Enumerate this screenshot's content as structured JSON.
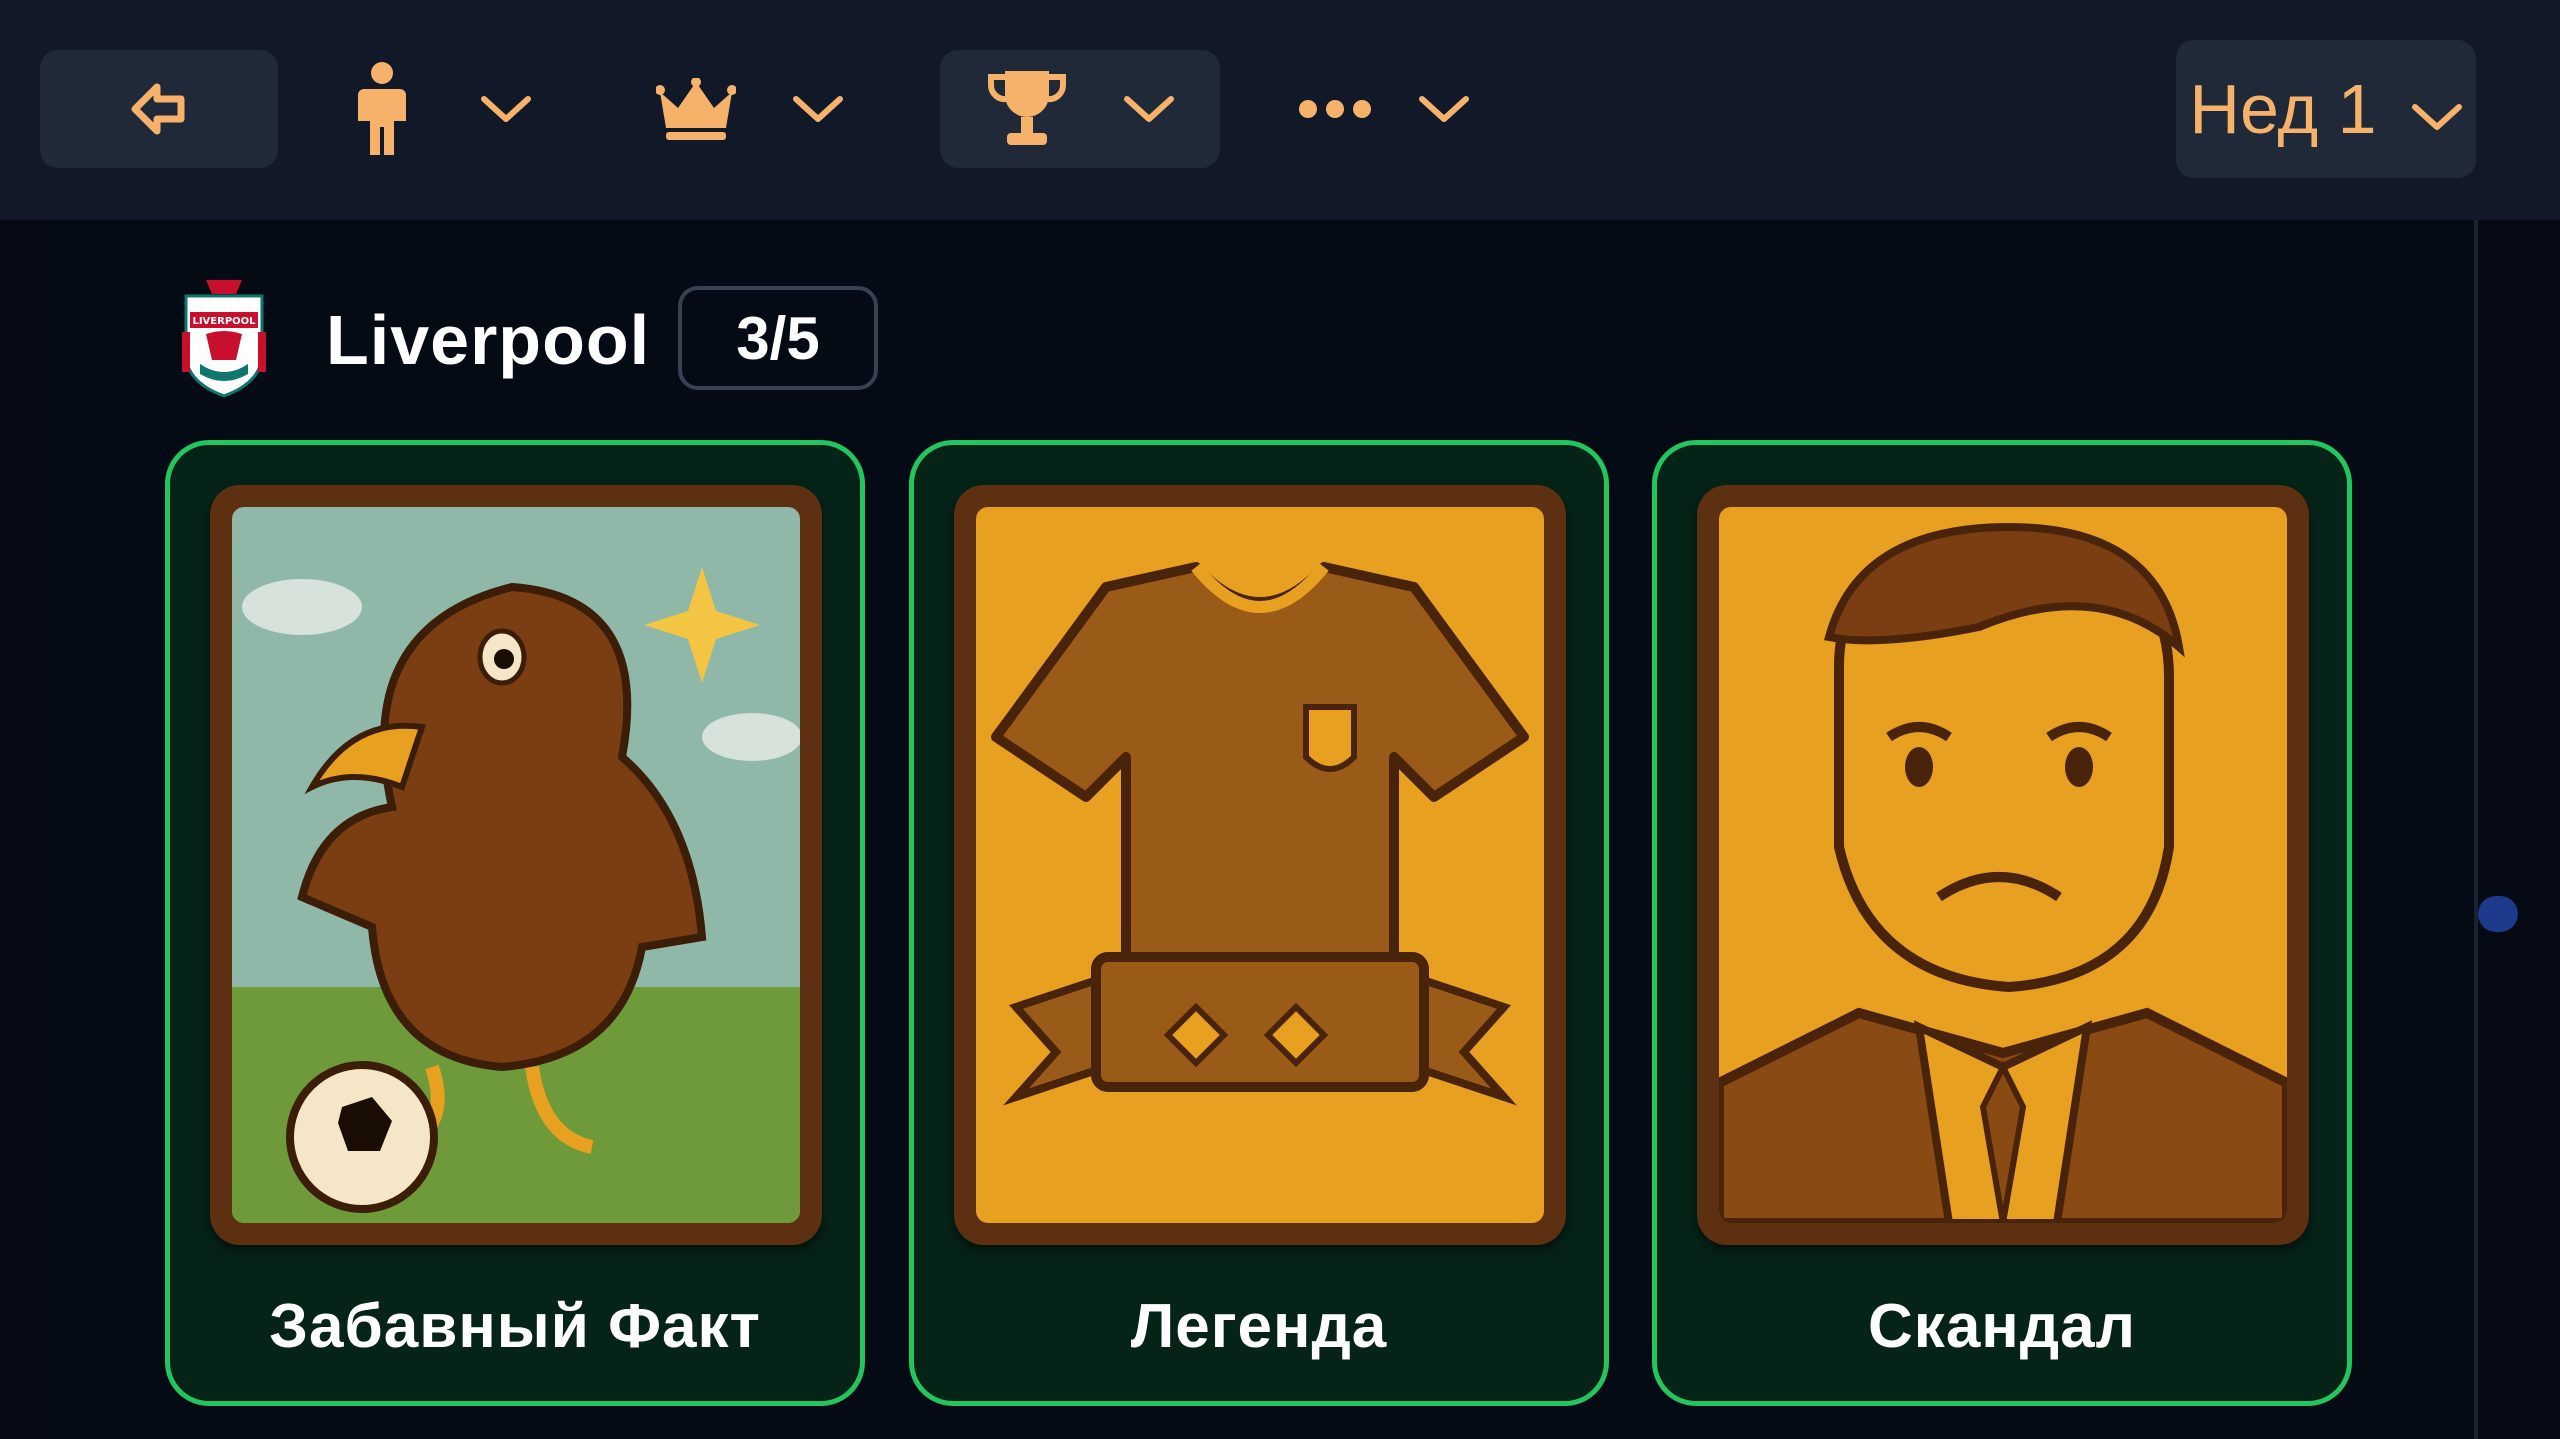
{
  "toolbar": {
    "week_label": "Нед 1",
    "accent": "#f6b26b",
    "icons": [
      "back-arrow-icon",
      "person-icon",
      "crown-icon",
      "trophy-icon",
      "more-dots-icon",
      "chevron-down-icon"
    ]
  },
  "team": {
    "name": "Liverpool",
    "count": "3/5",
    "crest_text": "LIVERPOOL"
  },
  "cards": [
    {
      "label": "Забавный Факт",
      "art": "eagle-with-ball"
    },
    {
      "label": "Легенда",
      "art": "jersey-banner"
    },
    {
      "label": "Скандал",
      "art": "worried-man"
    }
  ],
  "colors": {
    "card_border": "#22c55e",
    "card_bg": "#062318",
    "art_gold": "#e8a020",
    "art_brown": "#7a3e12"
  }
}
